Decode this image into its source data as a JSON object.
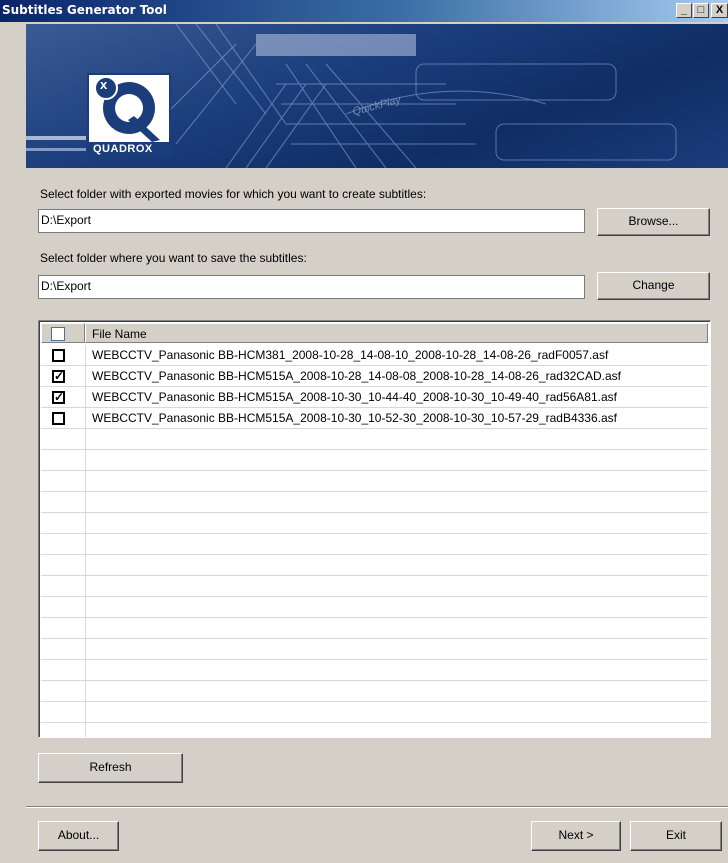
{
  "window": {
    "title": "Subtitles Generator Tool",
    "minimize": "_",
    "maximize": "□",
    "close": "X"
  },
  "banner": {
    "brand": "QUADROX",
    "logo_letter_x": "x",
    "logo_letter_q": "Q",
    "tagline": "QuickPlay"
  },
  "export_folder": {
    "label": "Select folder with exported movies for which you want to create subtitles:",
    "value": "D:\\Export",
    "button": "Browse..."
  },
  "save_folder": {
    "label": "Select folder where you want to save the subtitles:",
    "value": "D:\\Export",
    "button": "Change"
  },
  "file_list": {
    "header": "File Name",
    "rows": [
      {
        "name": "WEBCCTV_Panasonic BB-HCM381_2008-10-28_14-08-10_2008-10-28_14-08-26_radF0057.asf",
        "checked": false
      },
      {
        "name": "WEBCCTV_Panasonic BB-HCM515A_2008-10-28_14-08-08_2008-10-28_14-08-26_rad32CAD.asf",
        "checked": true
      },
      {
        "name": "WEBCCTV_Panasonic BB-HCM515A_2008-10-30_10-44-40_2008-10-30_10-49-40_rad56A81.asf",
        "checked": true
      },
      {
        "name": "WEBCCTV_Panasonic BB-HCM515A_2008-10-30_10-52-30_2008-10-30_10-57-29_radB4336.asf",
        "checked": false
      }
    ],
    "check_mark": "✓"
  },
  "buttons": {
    "refresh": "Refresh",
    "about": "About...",
    "next": "Next >",
    "exit": "Exit"
  },
  "colors": {
    "titlebar": "#0a246a",
    "banner": "#1b3d7b",
    "face": "#d4d0c8"
  }
}
